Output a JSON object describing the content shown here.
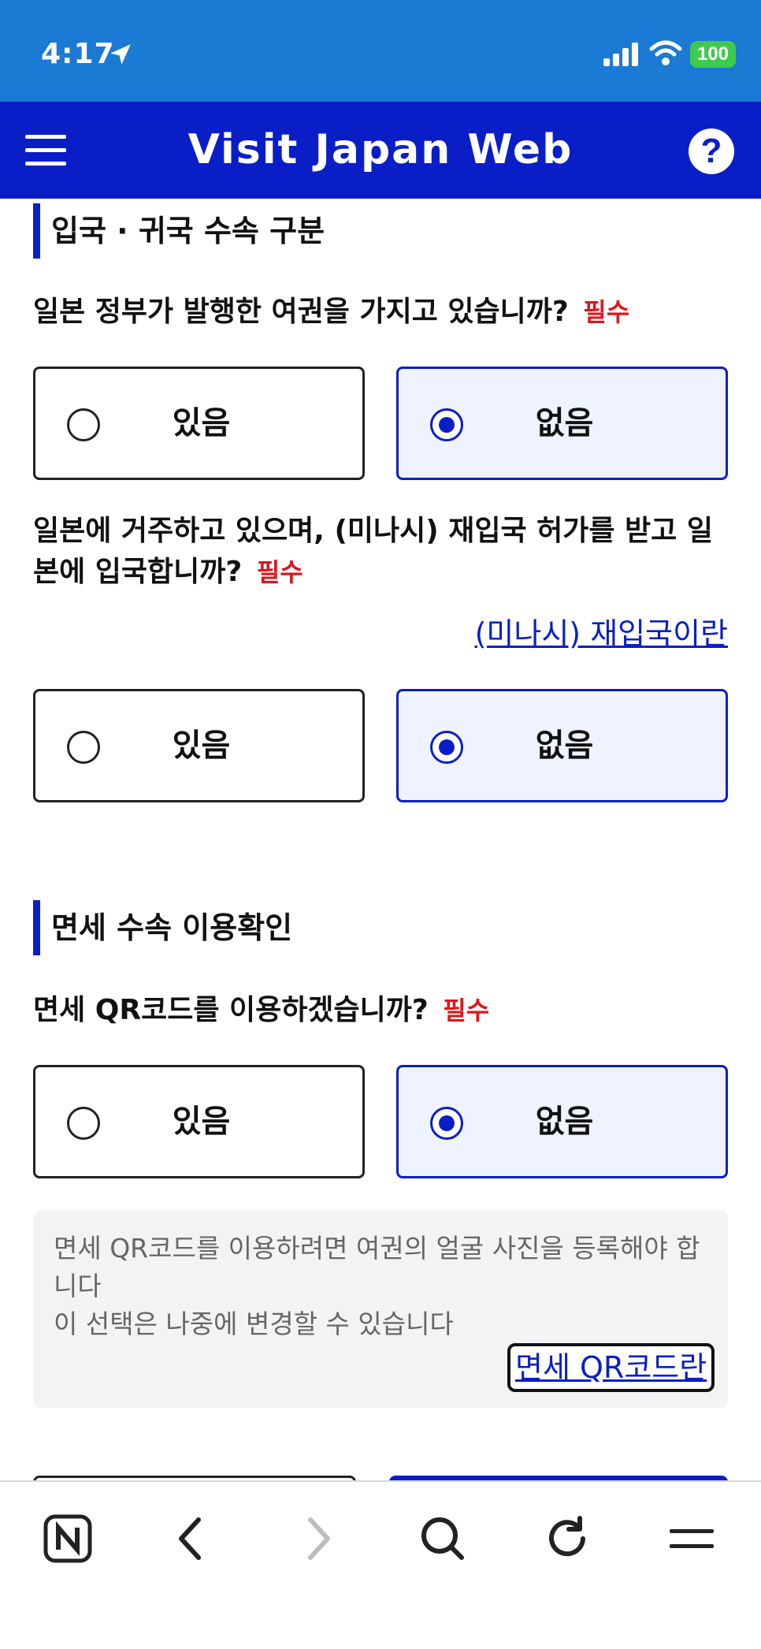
{
  "status_bar": {
    "time": "4:17",
    "battery": "100",
    "icons": [
      "location-arrow-icon",
      "cellular-signal-icon",
      "wifi-icon",
      "battery-icon"
    ]
  },
  "app_bar": {
    "title": "Visit Japan Web",
    "help_label": "?",
    "icons": [
      "hamburger-menu-icon",
      "help-icon"
    ]
  },
  "section1": {
    "title": "입국 · 귀국 수속 구분",
    "q1": {
      "text": "일본 정부가 발행한 여권을 가지고 있습니까?",
      "required": "필수",
      "options": [
        "있음",
        "없음"
      ],
      "selected": "없음"
    },
    "q2": {
      "text": "일본에 거주하고 있으며, (미나시) 재입국 허가를 받고 일본에 입국합니까?",
      "required": "필수",
      "link": "(미나시) 재입국이란",
      "options": [
        "있음",
        "없음"
      ],
      "selected": "없음"
    }
  },
  "section2": {
    "title": "면세 수속 이용확인",
    "q3": {
      "text": "면세 QR코드를 이용하겠습니까?",
      "required": "필수",
      "options": [
        "있음",
        "없음"
      ],
      "selected": "없음"
    },
    "info": {
      "line1": "면세 QR코드를 이용하려면 여권의 얼굴 사진을 등록해야 합니다",
      "line2": "이 선택은 나중에 변경할 수 있습니다",
      "link": "면세 QR코드란"
    }
  },
  "browser_toolbar": {
    "icons": [
      "naver-home-icon",
      "back-icon",
      "forward-icon",
      "search-icon",
      "reload-icon",
      "menu-icon"
    ]
  },
  "colors": {
    "status_bar": "#1a7ad4",
    "brand_blue": "#0a1ec8",
    "required_red": "#e0161b",
    "selected_bg": "#eef3ff",
    "info_bg": "#f2f3f5"
  }
}
